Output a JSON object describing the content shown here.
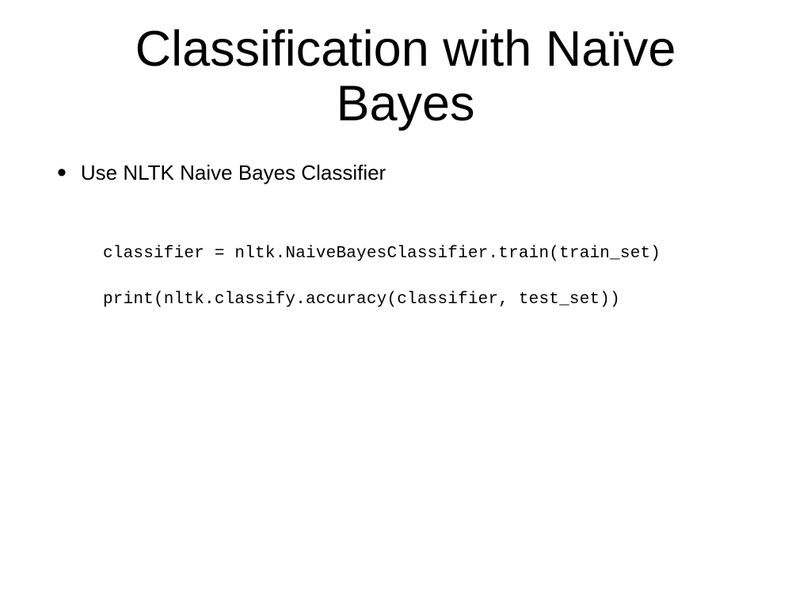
{
  "title_line1": "Classification with Naïve",
  "title_line2": "Bayes",
  "bullet_text": "Use NLTK Naive Bayes Classifier",
  "code_line1": "classifier = nltk.NaiveBayesClassifier.train(train_set)",
  "code_line2": "print(nltk.classify.accuracy(classifier, test_set))"
}
